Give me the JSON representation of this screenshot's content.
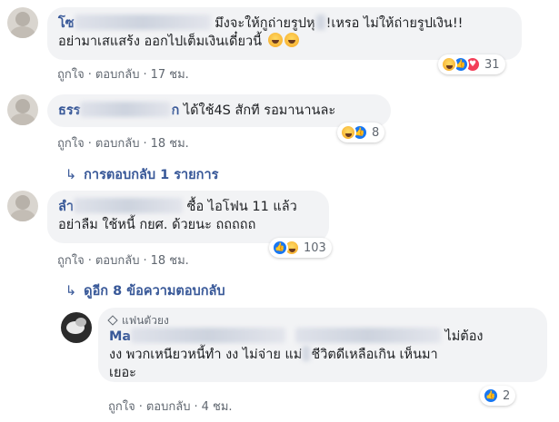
{
  "actions": {
    "like": "ถูกใจ",
    "reply": "ตอบกลับ",
    "separator": "·"
  },
  "comments": [
    {
      "name_visible": "โซ",
      "text_line1": "มึงจะให้กูถ่ายรูปหุ",
      "text_line1b": "!เหรอ ไม่ให้ถ่ายรูปเงิน!!",
      "text_line2": "อย่ามาเสแสร้ง ออกไปเต็มเงินเดี๋ยวนี้",
      "time": "17 ชม.",
      "reaction_count": "31",
      "reactions": [
        "haha-icon",
        "like-icon",
        "love-icon"
      ]
    },
    {
      "name_visible": "ธรร",
      "name_tail": "ก",
      "text_line1": "ได้ใช้4S สักที รอมานานละ",
      "time": "18 ชม.",
      "reaction_count": "8",
      "reactions": [
        "haha-icon",
        "like-icon"
      ],
      "replies_link": "การตอบกลับ 1 รายการ"
    },
    {
      "name_visible": "ลำ",
      "text_line1": "ซื้อ ไอโฟน 11 แล้ว",
      "text_line2": "อย่าลืม ใช้หนี้ กยศ. ด้วยนะ ถถถถถ",
      "time": "18 ชม.",
      "reaction_count": "103",
      "reactions": [
        "like-icon",
        "haha-icon"
      ],
      "replies_link": "ดูอีก 8 ข้อความตอบกลับ"
    }
  ],
  "reply": {
    "badge": "แฟนตัวยง",
    "name_visible": "Ma",
    "text_line1_tail": "ไม่ต้อง",
    "text_line2a": "งง พวกเหนียวหนี้ทำ งง ไม่จ่าย แม่",
    "text_line2b": "ชีวิตดีเหลือเกิน เห็นมา",
    "text_line3": "เยอะ",
    "time": "4 ชม.",
    "reaction_count": "2",
    "reactions": [
      "like-icon"
    ]
  }
}
